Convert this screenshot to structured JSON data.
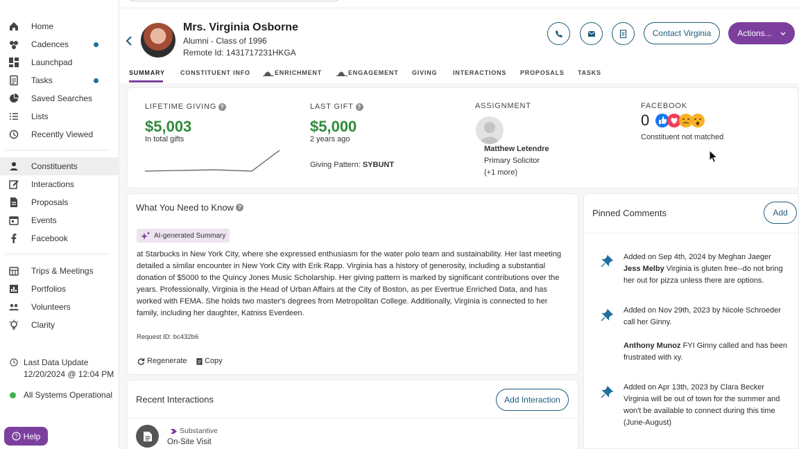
{
  "sidebar": {
    "nav_primary": [
      {
        "label": "Home",
        "icon": "home-icon"
      },
      {
        "label": "Cadences",
        "icon": "cadences-icon",
        "dot": true
      },
      {
        "label": "Launchpad",
        "icon": "launchpad-icon"
      },
      {
        "label": "Tasks",
        "icon": "tasks-icon",
        "dot": true
      },
      {
        "label": "Saved Searches",
        "icon": "pie-chart-icon"
      },
      {
        "label": "Lists",
        "icon": "list-icon"
      },
      {
        "label": "Recently Viewed",
        "icon": "history-icon"
      }
    ],
    "nav_secondary": [
      {
        "label": "Constituents",
        "icon": "person-icon",
        "active": true
      },
      {
        "label": "Interactions",
        "icon": "edit-icon"
      },
      {
        "label": "Proposals",
        "icon": "document-icon"
      },
      {
        "label": "Events",
        "icon": "calendar-icon"
      },
      {
        "label": "Facebook",
        "icon": "facebook-icon"
      }
    ],
    "nav_tertiary": [
      {
        "label": "Trips & Meetings",
        "icon": "calendar-grid-icon"
      },
      {
        "label": "Portfolios",
        "icon": "bar-chart-icon"
      },
      {
        "label": "Volunteers",
        "icon": "people-icon"
      },
      {
        "label": "Clarity",
        "icon": "lightbulb-icon"
      }
    ],
    "last_update_label": "Last Data Update",
    "last_update_value": "12/20/2024 @ 12:04 PM",
    "systems_status": "All Systems Operational",
    "help_label": "Help"
  },
  "profile": {
    "name": "Mrs. Virginia Osborne",
    "subtitle": "Alumni - Class of 1996",
    "remote_id": "Remote Id: 1431717231HKGA",
    "contact_button": "Contact Virginia",
    "actions_button": "Actions..."
  },
  "tabs": [
    "SUMMARY",
    "CONSTITUENT INFO",
    "ENRICHMENT",
    "ENGAGEMENT",
    "GIVING",
    "INTERACTIONS",
    "PROPOSALS",
    "TASKS"
  ],
  "summary": {
    "lifetime_label": "LIFETIME GIVING",
    "lifetime_value": "$5,003",
    "lifetime_sub": "In total gifts",
    "last_gift_label": "LAST GIFT",
    "last_gift_value": "$5,000",
    "last_gift_sub": "2 years ago",
    "giving_pattern_label": "Giving Pattern:",
    "giving_pattern_value": "SYBUNT",
    "assignment_label": "ASSIGNMENT",
    "assignee_name": "Matthew Letendre",
    "assignee_role": "Primary Solicitor",
    "assignee_more": "(+1 more)",
    "facebook_label": "FACEBOOK",
    "facebook_count": "0",
    "facebook_status": "Constituent not matched"
  },
  "need_to_know": {
    "title": "What You Need to Know",
    "badge": "AI-generated Summary",
    "text": "at Starbucks in New York City, where she expressed enthusiasm for the water polo team and sustainability. Her last meeting detailed a similar encounter in New York City with Erik Rapp. Virginia has a history of generosity, including a substantial donation of $5000 to the Quincy Jones Music Scholarship. Her giving pattern is marked by significant contributions over the years. Professionally, Virginia is the Head of Urban Affairs at the City of Boston, as per Evertrue Enriched Data, and has worked with FEMA. She holds two master's degrees from Metropolitan College. Additionally, Virginia is connected to her family, including her daughter, Katniss Everdeen.",
    "request_id": "Request ID: bc432b6",
    "regenerate": "Regenerate",
    "copy": "Copy"
  },
  "recent_interactions": {
    "title": "Recent Interactions",
    "add_button": "Add Interaction",
    "item_tag": "Substantive",
    "item_title": "On-Site Visit"
  },
  "pinned": {
    "title": "Pinned Comments",
    "add_button": "Add",
    "comments": [
      {
        "meta": "Added on Sep 4th, 2024 by Meghan Jaeger",
        "mention": "Jess Melby",
        "body": " Virginia is gluten free--do not bring her out for pizza unless there are options."
      },
      {
        "meta": "Added on Nov 29th, 2023 by Nicole Schroeder",
        "body": "call her Ginny.",
        "mention2": "Anthony Munoz",
        "body2": " FYI Ginny called and has been frustrated with xy."
      },
      {
        "meta": "Added on Apr 13th, 2023 by Clara Becker",
        "body": "Virginia will be out of town for the summer and won't be available to connect during this time (June-August)"
      }
    ]
  },
  "colors": {
    "accent_purple": "#7c3f9e",
    "brand_blue": "#1f5a7a",
    "green": "#2e8b3a"
  }
}
